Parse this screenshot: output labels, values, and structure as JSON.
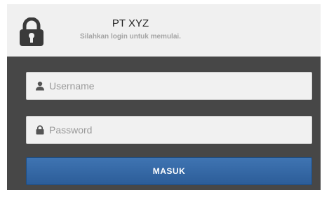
{
  "header": {
    "title": "PT XYZ",
    "subtitle": "Silahkan login untuk memulai.",
    "icon": "lock-icon"
  },
  "form": {
    "username": {
      "placeholder": "Username",
      "value": "",
      "icon": "user-icon"
    },
    "password": {
      "placeholder": "Password",
      "value": "",
      "icon": "lock-small-icon"
    },
    "submit_label": "MASUK"
  },
  "colors": {
    "header_bg": "#f0f0f0",
    "body_bg": "#474747",
    "input_bg": "#f1f1f1",
    "button_bg": "#2f62a0",
    "button_text": "#ffffff"
  }
}
